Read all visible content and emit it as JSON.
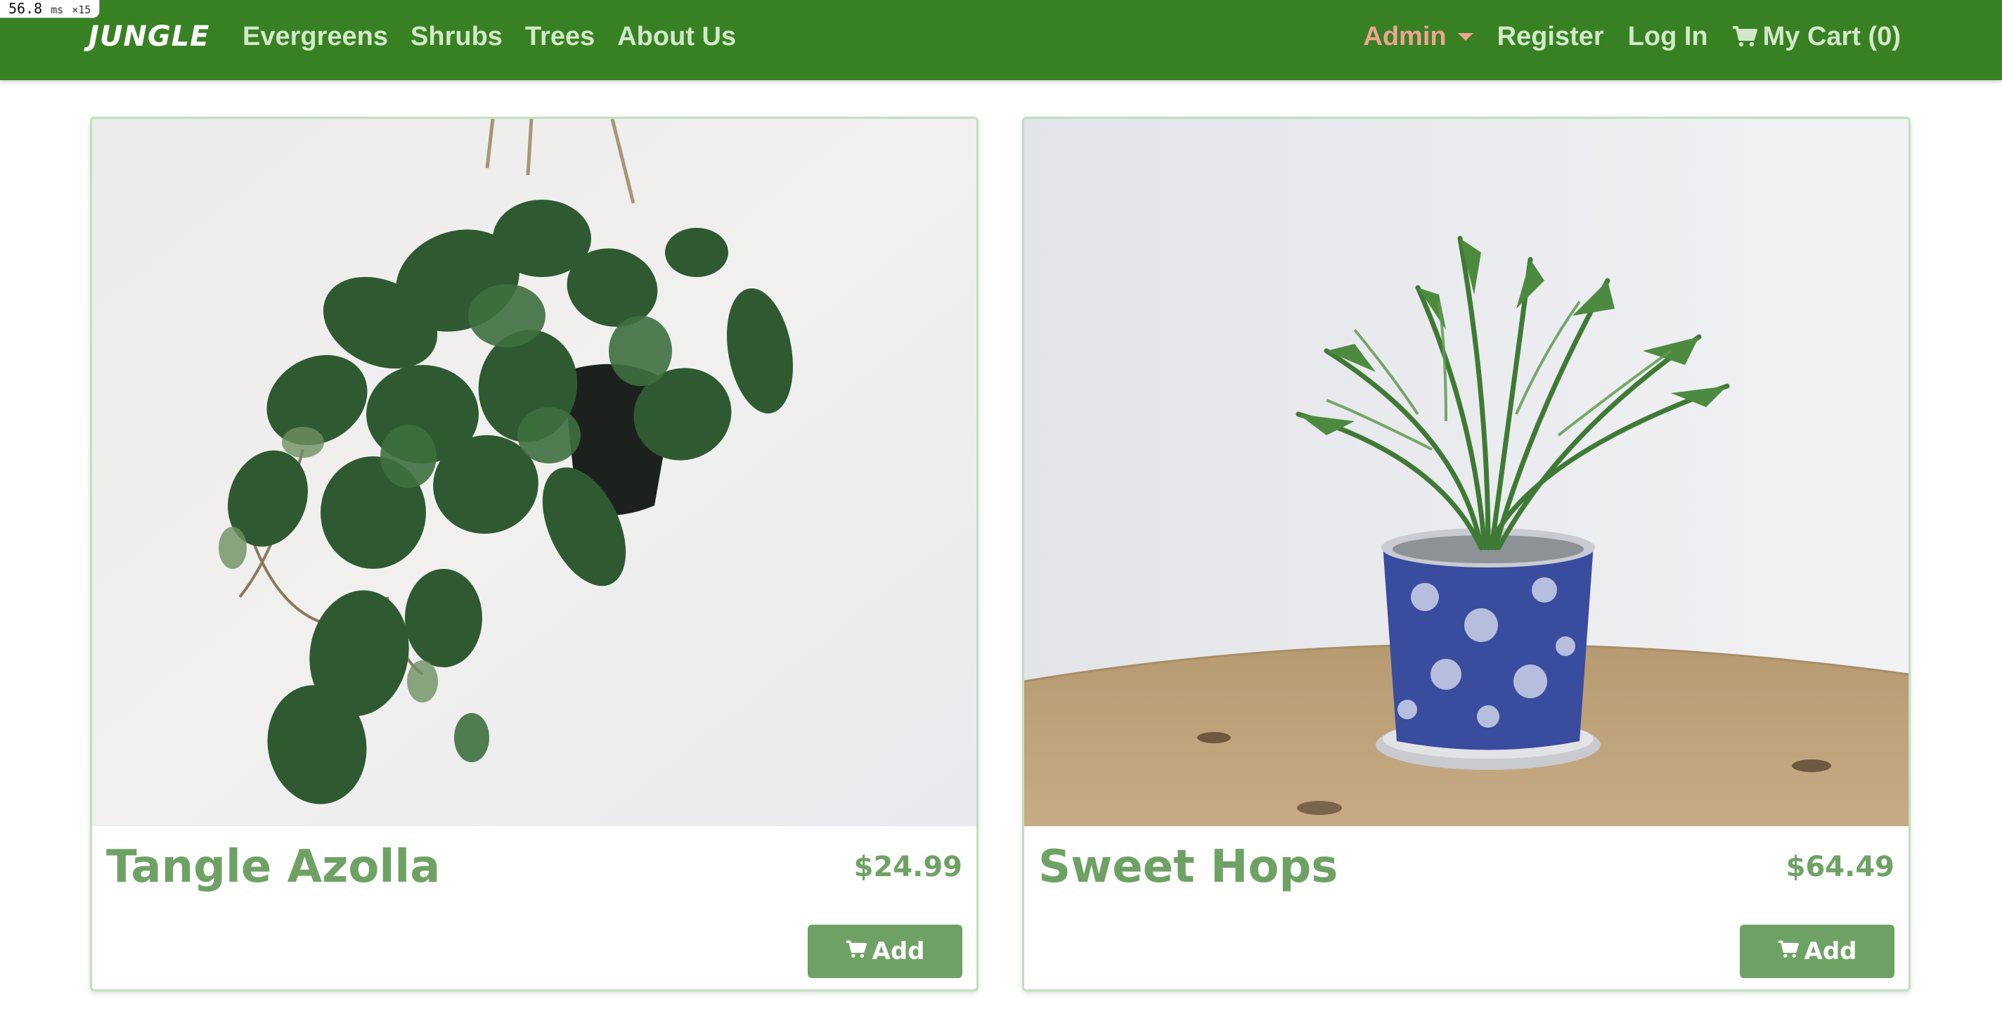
{
  "perf": {
    "value": "56.8",
    "unit": "ms",
    "multiplier": "×15"
  },
  "navbar": {
    "brand": "JUNGLE",
    "left_links": [
      "Evergreens",
      "Shrubs",
      "Trees",
      "About Us"
    ],
    "admin_label": "Admin",
    "register_label": "Register",
    "login_label": "Log In",
    "cart_label": "My Cart (0)"
  },
  "products": [
    {
      "name": "Tangle Azolla",
      "price": "$24.99",
      "add_label": "Add",
      "image": "hanging-pothos-plant"
    },
    {
      "name": "Sweet Hops",
      "price": "$64.49",
      "add_label": "Add",
      "image": "palm-in-blue-pot"
    }
  ],
  "colors": {
    "navbar_bg": "#378122",
    "nav_link": "#d3e8c9",
    "admin_link": "#f0a393",
    "accent_green": "#6ea264",
    "card_border": "#bfe0bc"
  }
}
